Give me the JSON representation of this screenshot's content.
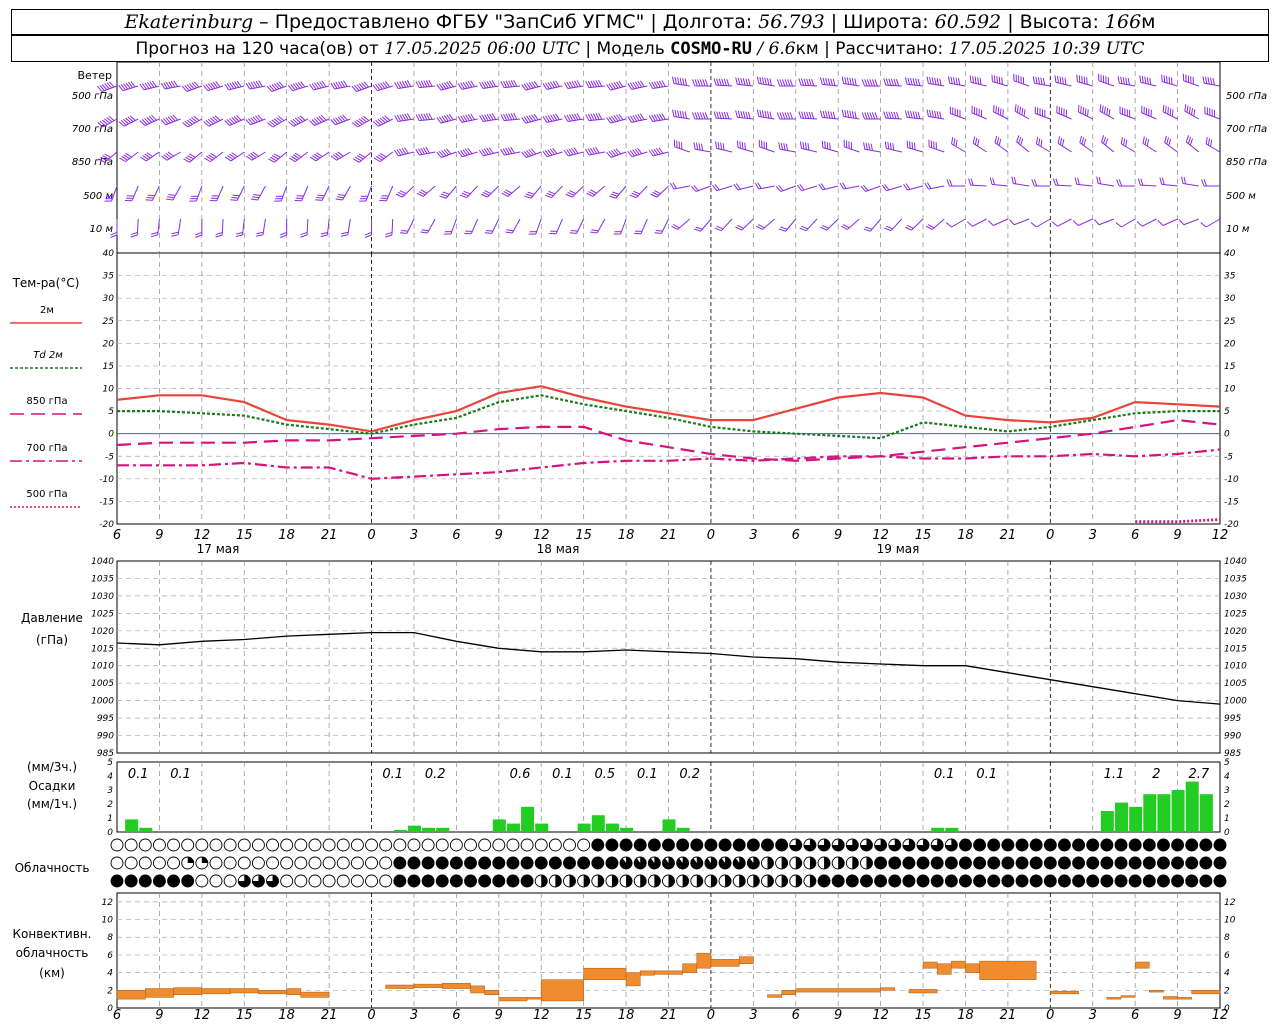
{
  "header": {
    "station": "Ekaterinburg",
    "provider": "– Предоставлено ФГБУ \"ЗапСиб УГМС\" | Долгота:",
    "lon": "56.793",
    "lat_label": "| Широта:",
    "lat": "60.592",
    "alt_label": "| Высота:",
    "alt": "166",
    "alt_unit": "м",
    "forecast_label": "Прогноз на 120 часа(ов) от",
    "init_time": "17.05.2025 06:00 UTC",
    "model_label": "| Модель",
    "model": "COSMO-RU",
    "resolution": "/ 6.6",
    "res_unit": "км",
    "calc_label": "| Рассчитано:",
    "calc_time": "17.05.2025 10:39 UTC"
  },
  "labels": {
    "wind": "Ветер",
    "wind_levels": [
      "500 гПа",
      "700 гПа",
      "850 гПа",
      "500 м",
      "10 м"
    ],
    "temp_title": "Тем-ра(°C)",
    "temp_legend": [
      "2м",
      "Td 2м",
      "850 гПа",
      "700 гПа",
      "500 гПа"
    ],
    "pressure_title": "Давление",
    "pressure_unit": "(гПа)",
    "precip_units_3h": "(мм/3ч.)",
    "precip_title": "Осадки",
    "precip_units_1h": "(мм/1ч.)",
    "cloud_title": "Облачность",
    "conv_title": [
      "Конвективн.",
      "облачность",
      "(км)"
    ],
    "dates": [
      "17 мая",
      "18 мая",
      "19 мая"
    ]
  },
  "colors": {
    "t2m": "#e8443a",
    "td2m": "#1a7a1a",
    "t850": "#d6127e",
    "t700": "#d6127e",
    "t500": "#d6127e",
    "wind_barb": "#8a2be2",
    "precip": "#22cc22",
    "convective": "#f08c30",
    "pressure": "#000000"
  },
  "chart_data": [
    {
      "type": "line",
      "name": "temperature",
      "x_ticks": [
        "6",
        "9",
        "12",
        "15",
        "18",
        "21",
        "0",
        "3",
        "6",
        "9",
        "12",
        "15",
        "18",
        "21",
        "0",
        "3",
        "6",
        "9",
        "12",
        "15",
        "18",
        "21",
        "0",
        "3",
        "6",
        "9",
        "12"
      ],
      "ylim": [
        -20,
        40
      ],
      "y_ticks": [
        40,
        35,
        30,
        25,
        20,
        15,
        10,
        5,
        0,
        -5,
        -10,
        -15,
        -20
      ],
      "x_hours": [
        0,
        3,
        6,
        9,
        12,
        15,
        18,
        21,
        24,
        27,
        30,
        33,
        36,
        39,
        42,
        45,
        48,
        51,
        54,
        57,
        60,
        63,
        66,
        69,
        72,
        75,
        78
      ],
      "series": [
        {
          "name": "2м",
          "values": [
            7.5,
            8.5,
            8.5,
            7,
            3,
            2,
            0.5,
            3,
            5,
            9,
            10.5,
            8,
            6,
            4.5,
            3,
            3,
            5.5,
            8,
            9,
            8,
            4,
            3,
            2.5,
            3.5,
            7,
            6.5,
            6
          ]
        },
        {
          "name": "Td 2м",
          "values": [
            5,
            5,
            4.5,
            4,
            2,
            1,
            0,
            2,
            3.5,
            7,
            8.5,
            6.5,
            5,
            3.5,
            1.5,
            0.5,
            0,
            -0.5,
            -1,
            2.5,
            1.5,
            0.5,
            1.5,
            3,
            4.5,
            5,
            5
          ]
        },
        {
          "name": "850 гПа",
          "values": [
            -2.5,
            -2,
            -2,
            -2,
            -1.5,
            -1.5,
            -1,
            -0.5,
            0,
            1,
            1.5,
            1.5,
            -1.5,
            -3,
            -4.5,
            -5.5,
            -6,
            -5.5,
            -5,
            -4,
            -3,
            -2,
            -1,
            0,
            1.5,
            3,
            2
          ]
        },
        {
          "name": "700 гПа",
          "values": [
            -7,
            -7,
            -7,
            -6.5,
            -7.5,
            -7.5,
            -10,
            -9.5,
            -9,
            -8.5,
            -7.5,
            -6.5,
            -6,
            -6,
            -5.5,
            -6,
            -5.5,
            -5,
            -5,
            -5.5,
            -5.5,
            -5,
            -5,
            -4.5,
            -5,
            -4.5,
            -3.5
          ]
        },
        {
          "name": "500 гПа",
          "values": [
            null,
            null,
            null,
            null,
            null,
            null,
            null,
            null,
            null,
            null,
            null,
            null,
            null,
            null,
            null,
            null,
            null,
            null,
            null,
            null,
            null,
            null,
            null,
            null,
            -19.5,
            -19.5,
            -19
          ]
        }
      ]
    },
    {
      "type": "line",
      "name": "pressure",
      "ylim": [
        985,
        1040
      ],
      "y_ticks": [
        1040,
        1035,
        1030,
        1025,
        1020,
        1015,
        1010,
        1005,
        1000,
        995,
        990,
        985
      ],
      "x_hours": [
        0,
        3,
        6,
        9,
        12,
        15,
        18,
        21,
        24,
        27,
        30,
        33,
        36,
        39,
        42,
        45,
        48,
        51,
        54,
        57,
        60,
        63,
        66,
        69,
        72,
        75,
        78
      ],
      "values": [
        1016.5,
        1016,
        1017,
        1017.5,
        1018.5,
        1019,
        1019.5,
        1019.5,
        1017,
        1015,
        1014,
        1014,
        1014.5,
        1014,
        1013.5,
        1012.5,
        1012,
        1011,
        1010.5,
        1010,
        1010,
        1008,
        1006,
        1004,
        1002,
        1000,
        999
      ]
    },
    {
      "type": "bar",
      "name": "precipitation",
      "totals_3h": [
        {
          "hour": 1.5,
          "label": "0.1"
        },
        {
          "hour": 4.5,
          "label": "0.1"
        },
        {
          "hour": 19.5,
          "label": "0.1"
        },
        {
          "hour": 22.5,
          "label": "0.2"
        },
        {
          "hour": 28.5,
          "label": "0.6"
        },
        {
          "hour": 31.5,
          "label": "0.1"
        },
        {
          "hour": 34.5,
          "label": "0.5"
        },
        {
          "hour": 37.5,
          "label": "0.1"
        },
        {
          "hour": 40.5,
          "label": "0.2"
        },
        {
          "hour": 58.5,
          "label": "0.1"
        },
        {
          "hour": 61.5,
          "label": "0.1"
        },
        {
          "hour": 70.5,
          "label": "1.1"
        },
        {
          "hour": 73.5,
          "label": "2"
        },
        {
          "hour": 76.5,
          "label": "2.7"
        }
      ],
      "hourly": [
        [
          1,
          0.3
        ],
        [
          2,
          0.1
        ],
        [
          20,
          0.05
        ],
        [
          21,
          0.15
        ],
        [
          22,
          0.1
        ],
        [
          23,
          0.1
        ],
        [
          27,
          0.3
        ],
        [
          28,
          0.2
        ],
        [
          29,
          0.6
        ],
        [
          30,
          0.2
        ],
        [
          33,
          0.2
        ],
        [
          34,
          0.4
        ],
        [
          35,
          0.2
        ],
        [
          36,
          0.1
        ],
        [
          39,
          0.3
        ],
        [
          40,
          0.1
        ],
        [
          58,
          0.1
        ],
        [
          59,
          0.1
        ],
        [
          70,
          0.5
        ],
        [
          71,
          0.7
        ],
        [
          72,
          0.6
        ],
        [
          73,
          0.9
        ],
        [
          74,
          0.9
        ],
        [
          75,
          1.0
        ],
        [
          76,
          1.2
        ],
        [
          77,
          0.9
        ]
      ],
      "ylim": [
        0,
        5
      ]
    },
    {
      "type": "bar",
      "name": "convective_clouds",
      "ylim": [
        0,
        13
      ],
      "y_ticks": [
        0,
        2,
        4,
        6,
        8,
        10,
        12
      ],
      "layers": [
        [
          0,
          2,
          1,
          2
        ],
        [
          2,
          4,
          1.2,
          2.2
        ],
        [
          4,
          6,
          1.5,
          2.3
        ],
        [
          6,
          8,
          1.6,
          2.2
        ],
        [
          8,
          10,
          1.7,
          2.2
        ],
        [
          10,
          12,
          1.6,
          2
        ],
        [
          12,
          13,
          1.5,
          2.2
        ],
        [
          13,
          15,
          1.2,
          1.8
        ],
        [
          19,
          21,
          2.2,
          2.6
        ],
        [
          21,
          23,
          2.3,
          2.7
        ],
        [
          23,
          25,
          2.2,
          2.8
        ],
        [
          25,
          26,
          1.7,
          2.5
        ],
        [
          26,
          27,
          1.5,
          2
        ],
        [
          27,
          29,
          0.8,
          1.2
        ],
        [
          29,
          30,
          1,
          1.2
        ],
        [
          30,
          33,
          0.8,
          3.2
        ],
        [
          33,
          36,
          3.2,
          4.5
        ],
        [
          36,
          37,
          2.5,
          4
        ],
        [
          37,
          38,
          3.7,
          4.2
        ],
        [
          38,
          40,
          3.8,
          4.2
        ],
        [
          40,
          41,
          4,
          5
        ],
        [
          41,
          42,
          4.5,
          6.2
        ],
        [
          42,
          44,
          4.7,
          5.5
        ],
        [
          44,
          45,
          5,
          5.8
        ],
        [
          46,
          47,
          1.2,
          1.5
        ],
        [
          47,
          48,
          1.5,
          2
        ],
        [
          48,
          54,
          1.8,
          2.2
        ],
        [
          54,
          55,
          2,
          2.3
        ],
        [
          56,
          58,
          1.7,
          2.1
        ],
        [
          57,
          58,
          4.5,
          5.2
        ],
        [
          58,
          59,
          3.8,
          5
        ],
        [
          59,
          60,
          4.5,
          5.3
        ],
        [
          60,
          61,
          4,
          5
        ],
        [
          61,
          65,
          3.2,
          5.3
        ],
        [
          66,
          68,
          1.6,
          1.9
        ],
        [
          70,
          71,
          1,
          1.2
        ],
        [
          71,
          72,
          1.2,
          1.4
        ],
        [
          72,
          73,
          4.5,
          5.2
        ],
        [
          73,
          74,
          1.8,
          2
        ],
        [
          74,
          75,
          1,
          1.3
        ],
        [
          75,
          76,
          1,
          1.2
        ],
        [
          76,
          78,
          1.6,
          2
        ]
      ]
    }
  ]
}
